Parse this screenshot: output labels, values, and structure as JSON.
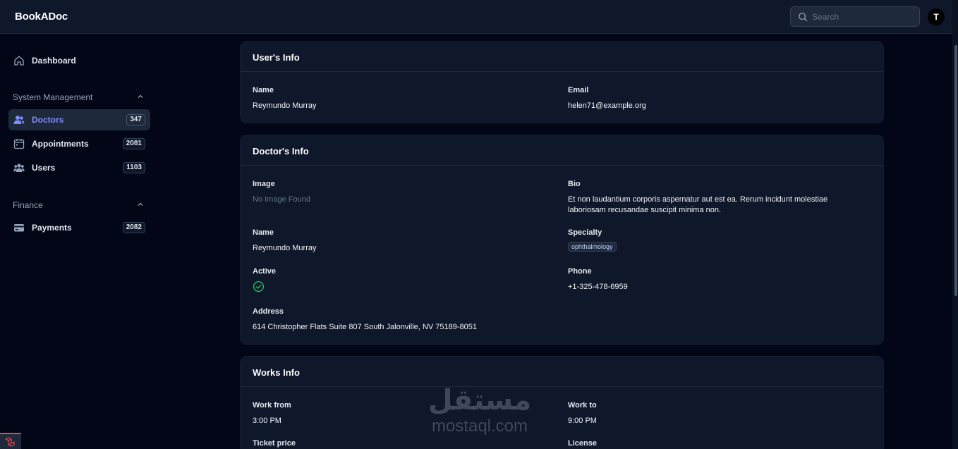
{
  "header": {
    "brand": "BookADoc",
    "search_placeholder": "Search",
    "avatar_initial": "T"
  },
  "sidebar": {
    "dashboard": {
      "label": "Dashboard",
      "icon": "home-icon"
    },
    "groups": [
      {
        "label": "System Management",
        "items": [
          {
            "label": "Doctors",
            "count": "347",
            "icon": "doctors-icon",
            "active": true
          },
          {
            "label": "Appointments",
            "count": "2081",
            "icon": "calendar-icon"
          },
          {
            "label": "Users",
            "count": "1103",
            "icon": "users-icon"
          }
        ]
      },
      {
        "label": "Finance",
        "items": [
          {
            "label": "Payments",
            "count": "2082",
            "icon": "credit-card-icon"
          }
        ]
      }
    ]
  },
  "users_info": {
    "title": "User's Info",
    "name_label": "Name",
    "name": "Reymundo Murray",
    "email_label": "Email",
    "email": "helen71@example.org"
  },
  "doctors_info": {
    "title": "Doctor's Info",
    "image_label": "Image",
    "image_value": "No Image Found",
    "bio_label": "Bio",
    "bio": "Et non laudantium corporis aspernatur aut est ea. Rerum incidunt molestiae laboriosam recusandae suscipit minima non.",
    "name_label": "Name",
    "name": "Reymundo Murray",
    "specialty_label": "Specialty",
    "specialty": "ophthalmology",
    "active_label": "Active",
    "phone_label": "Phone",
    "phone": "+1-325-478-6959",
    "address_label": "Address",
    "address": "614 Christopher Flats Suite 807 South Jalonville, NV 75189-8051"
  },
  "works_info": {
    "title": "Works Info",
    "work_from_label": "Work from",
    "work_from": "3:00 PM",
    "work_to_label": "Work to",
    "work_to": "9:00 PM",
    "ticket_price_label": "Ticket price",
    "license_label": "License"
  },
  "watermark": {
    "arabic": "مستقل",
    "latin": "mostaql.com"
  },
  "colors": {
    "accent": "#818cf8",
    "success": "#22c55e",
    "background": "#020617",
    "card": "#0f172a"
  }
}
